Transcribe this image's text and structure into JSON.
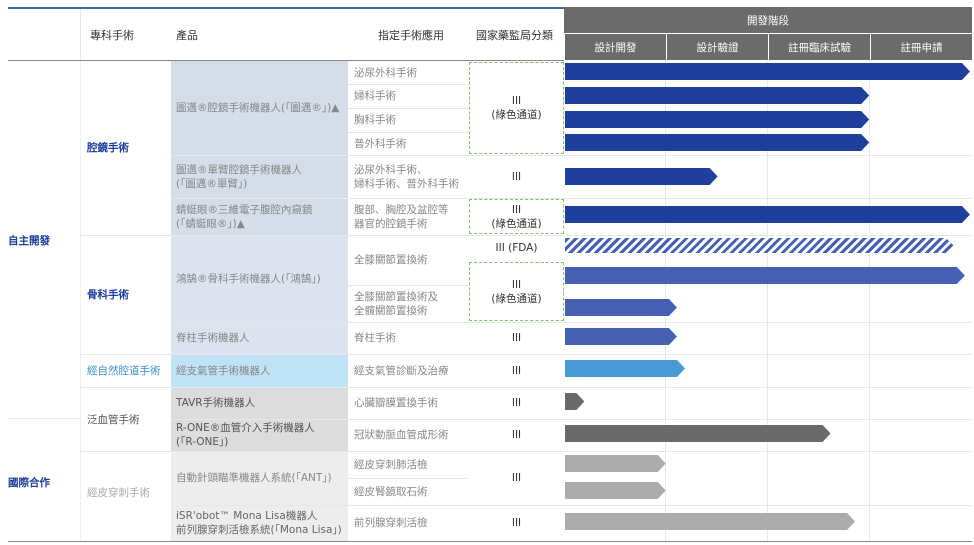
{
  "header": {
    "col_specialty": "專科手術",
    "col_product": "產品",
    "col_application": "指定手術應用",
    "col_nmpa": "國家藥監局分類",
    "stage_title": "開發階段",
    "stages": [
      "設計開發",
      "設計驗證",
      "註冊臨床試驗",
      "註冊申請"
    ]
  },
  "groups": {
    "self": "自主開發",
    "intl": "國際合作"
  },
  "specialties": {
    "laparo": "腔鏡手術",
    "ortho": "骨科手術",
    "natural": "經自然腔道手術",
    "vascular": "泛血管手術",
    "percut": "經皮穿刺手術"
  },
  "products": {
    "p1": "圖邁®腔鏡手術機器人(「圖邁®」)▲",
    "p2a": "圖邁®單臂腔鏡手術機器人",
    "p2b": "(「圖邁®單臂」)",
    "p3a": "蜻蜓眼®三維電子腹腔內窺鏡",
    "p3b": "(「蜻蜓眼®」)▲",
    "p4": "鴻鵠®骨科手術機器人(「鴻鵠」)",
    "p5": "脊柱手術機器人",
    "p6": "經支氣管手術機器人",
    "p7": "TAVR手術機器人",
    "p8a": "R-ONE®血管介入手術機器人",
    "p8b": "(「R-ONE」)",
    "p9": "自動針頭瞄準機器人系統(「ANT」)",
    "p10a": "iSR'obot™ Mona Lisa機器人",
    "p10b": "前列腺穿刺活檢系統(「Mona Lisa」)"
  },
  "applications": {
    "a1": "泌尿外科手術",
    "a2": "婦科手術",
    "a3": "胸科手術",
    "a4": "普外科手術",
    "a5a": "泌尿外科手術、",
    "a5b": "婦科手術、普外科手術",
    "a6a": "腹部、胸腔及盆腔等",
    "a6b": "器官的腔鏡手術",
    "a7": "全膝關節置換術",
    "a8a": "全膝關節置換術及",
    "a8b": "全髖關節置換術",
    "a9": "脊柱手術",
    "a10": "經支氣管診斷及治療",
    "a11": "心臟瓣膜置換手術",
    "a12": "冠狀動脈血管成形術",
    "a13": "經皮穿刺肺活檢",
    "a14": "經皮腎鏡取石術",
    "a15": "前列腺穿刺活檢"
  },
  "nmpa": {
    "green_l1": "III",
    "green_l2": "(綠色通道)",
    "iii": "III",
    "fda": "III (FDA)"
  },
  "colors": {
    "dark_blue": "#1f3f9c",
    "mid_blue": "#4660b4",
    "light_blue": "#4a9ad6",
    "dark_gray": "#6a6a6a",
    "light_gray": "#acacac"
  },
  "progress_bars_stages_completed": [
    {
      "row": "泌尿外科手術",
      "value": 3.98,
      "color": "dark_blue"
    },
    {
      "row": "婦科手術",
      "value": 2.99,
      "color": "dark_blue"
    },
    {
      "row": "胸科手術",
      "value": 2.99,
      "color": "dark_blue"
    },
    {
      "row": "普外科手術",
      "value": 2.99,
      "color": "dark_blue"
    },
    {
      "row": "圖邁單臂",
      "value": 1.5,
      "color": "dark_blue"
    },
    {
      "row": "蜻蜓眼",
      "value": 3.98,
      "color": "dark_blue"
    },
    {
      "row": "鴻鵠 FDA",
      "value": 3.82,
      "color": "mid_blue",
      "hatched": true
    },
    {
      "row": "鴻鵠 NMPA",
      "value": 3.93,
      "color": "mid_blue"
    },
    {
      "row": "全髖",
      "value": 1.1,
      "color": "mid_blue"
    },
    {
      "row": "脊柱",
      "value": 1.1,
      "color": "mid_blue"
    },
    {
      "row": "經支氣管",
      "value": 1.18,
      "color": "light_blue"
    },
    {
      "row": "TAVR",
      "value": 0.19,
      "color": "dark_gray"
    },
    {
      "row": "R-ONE",
      "value": 2.61,
      "color": "dark_gray"
    },
    {
      "row": "ANT 肺",
      "value": 0.99,
      "color": "light_gray"
    },
    {
      "row": "ANT 腎",
      "value": 0.99,
      "color": "light_gray"
    },
    {
      "row": "Mona Lisa",
      "value": 2.85,
      "color": "light_gray"
    }
  ]
}
